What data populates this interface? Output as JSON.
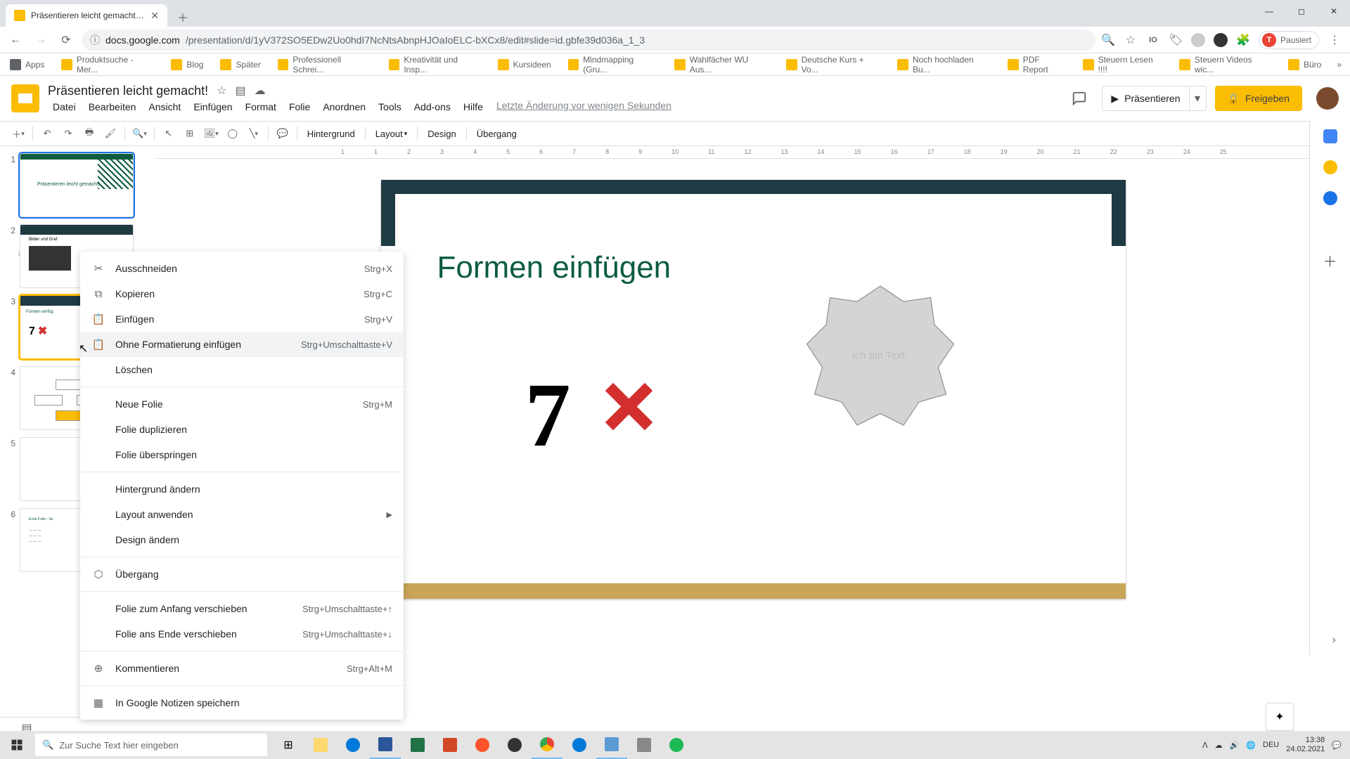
{
  "browser": {
    "tab_title": "Präsentieren leicht gemacht! - G...",
    "url_prefix": "docs.google.com",
    "url_path": "/presentation/d/1yV372SO5EDw2Uo0hdI7NcNtsAbnpHJOaIoELC-bXCx8/edit#slide=id.gbfe39d036a_1_3",
    "profile_status": "Pausiert"
  },
  "bookmarks": [
    {
      "label": "Apps",
      "type": "apps"
    },
    {
      "label": "Produktsuche - Mer..."
    },
    {
      "label": "Blog"
    },
    {
      "label": "Später"
    },
    {
      "label": "Professionell Schrei..."
    },
    {
      "label": "Kreativität und Insp..."
    },
    {
      "label": "Kursideen"
    },
    {
      "label": "Mindmapping  (Gru..."
    },
    {
      "label": "Wahlfächer WU Aus..."
    },
    {
      "label": "Deutsche Kurs + Vo..."
    },
    {
      "label": "Noch hochladen Bu..."
    },
    {
      "label": "PDF Report"
    },
    {
      "label": "Steuern Lesen !!!!"
    },
    {
      "label": "Steuern Videos wic..."
    },
    {
      "label": "Büro"
    }
  ],
  "doc": {
    "title": "Präsentieren leicht gemacht!"
  },
  "menus": {
    "file": "Datei",
    "edit": "Bearbeiten",
    "view": "Ansicht",
    "insert": "Einfügen",
    "format": "Format",
    "slide": "Folie",
    "arrange": "Anordnen",
    "tools": "Tools",
    "addons": "Add-ons",
    "help": "Hilfe",
    "last_change": "Letzte Änderung vor wenigen Sekunden"
  },
  "header": {
    "present": "Präsentieren",
    "share": "Freigeben"
  },
  "toolbar": {
    "background": "Hintergrund",
    "layout": "Layout",
    "design": "Design",
    "transition": "Übergang"
  },
  "ruler": [
    "1",
    "1",
    "2",
    "3",
    "4",
    "5",
    "6",
    "7",
    "8",
    "9",
    "10",
    "11",
    "12",
    "13",
    "14",
    "15",
    "16",
    "17",
    "18",
    "19",
    "20",
    "21",
    "22",
    "23",
    "24",
    "25"
  ],
  "slide": {
    "title": "Formen einfügen",
    "seven": "7",
    "shape_text": "Ich bin Text."
  },
  "thumbs": {
    "t1_text": "Präsentieren leicht gemacht!",
    "t2_title": "Bilder und Graf",
    "t3_title": "Formen einfüg",
    "t3_7x": "7",
    "selected_index": 3
  },
  "context_menu": [
    {
      "icon": "✂",
      "label": "Ausschneiden",
      "shortcut": "Strg+X"
    },
    {
      "icon": "⧉",
      "label": "Kopieren",
      "shortcut": "Strg+C"
    },
    {
      "icon": "📋",
      "label": "Einfügen",
      "shortcut": "Strg+V"
    },
    {
      "icon": "📋",
      "label": "Ohne Formatierung einfügen",
      "shortcut": "Strg+Umschalttaste+V",
      "hovered": true
    },
    {
      "icon": "",
      "label": "Löschen",
      "shortcut": ""
    },
    {
      "sep": true
    },
    {
      "icon": "",
      "label": "Neue Folie",
      "shortcut": "Strg+M"
    },
    {
      "icon": "",
      "label": "Folie duplizieren",
      "shortcut": ""
    },
    {
      "icon": "",
      "label": "Folie überspringen",
      "shortcut": ""
    },
    {
      "sep": true
    },
    {
      "icon": "",
      "label": "Hintergrund ändern",
      "shortcut": ""
    },
    {
      "icon": "",
      "label": "Layout anwenden",
      "shortcut": "",
      "submenu": true
    },
    {
      "icon": "",
      "label": "Design ändern",
      "shortcut": ""
    },
    {
      "sep": true
    },
    {
      "icon": "⬡",
      "label": "Übergang",
      "shortcut": ""
    },
    {
      "sep": true
    },
    {
      "icon": "",
      "label": "Folie zum Anfang verschieben",
      "shortcut": "Strg+Umschalttaste+↑"
    },
    {
      "icon": "",
      "label": "Folie ans Ende verschieben",
      "shortcut": "Strg+Umschalttaste+↓"
    },
    {
      "sep": true
    },
    {
      "icon": "⊕",
      "label": "Kommentieren",
      "shortcut": "Strg+Alt+M"
    },
    {
      "sep": true
    },
    {
      "icon": "▦",
      "label": "In Google Notizen speichern",
      "shortcut": ""
    }
  ],
  "taskbar": {
    "search_placeholder": "Zur Suche Text hier eingeben",
    "lang": "DEU",
    "time": "13:38",
    "date": "24.02.2021"
  }
}
